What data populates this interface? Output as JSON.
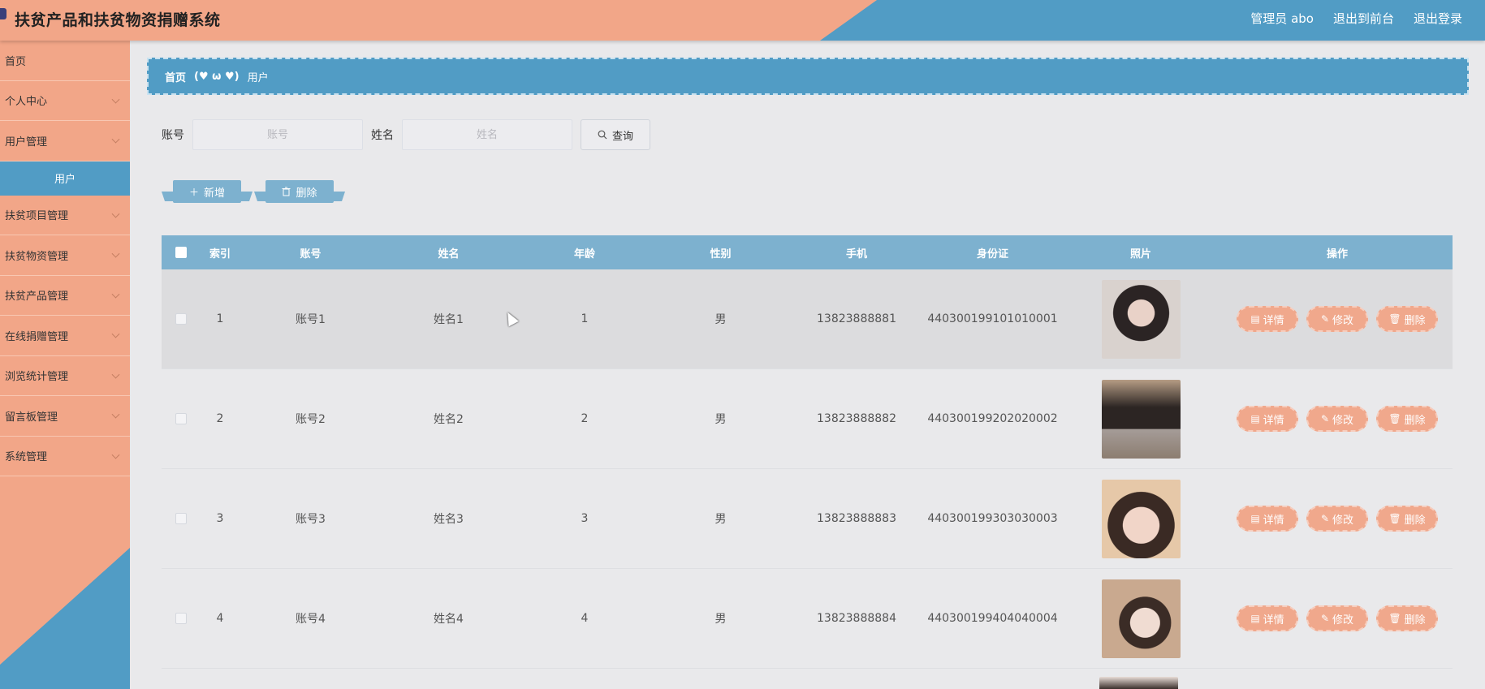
{
  "header": {
    "title": "扶贫产品和扶贫物资捐赠系统",
    "nav": [
      "管理员 abo",
      "退出到前台",
      "退出登录"
    ]
  },
  "sidebar": {
    "items": [
      {
        "label": "首页",
        "has_arrow": false
      },
      {
        "label": "个人中心",
        "has_arrow": true
      },
      {
        "label": "用户管理",
        "has_arrow": true
      },
      {
        "label": "扶贫项目管理",
        "has_arrow": true
      },
      {
        "label": "扶贫物资管理",
        "has_arrow": true
      },
      {
        "label": "扶贫产品管理",
        "has_arrow": true
      },
      {
        "label": "在线捐赠管理",
        "has_arrow": true
      },
      {
        "label": "浏览统计管理",
        "has_arrow": true
      },
      {
        "label": "留言板管理",
        "has_arrow": true
      },
      {
        "label": "系统管理",
        "has_arrow": true
      }
    ],
    "active_subitem": "用户"
  },
  "breadcrumb": {
    "home": "首页",
    "separator": "(♥ ω ♥)",
    "current": "用户"
  },
  "search": {
    "account_label": "账号",
    "account_placeholder": "账号",
    "name_label": "姓名",
    "name_placeholder": "姓名",
    "query_label": "查询"
  },
  "actions": {
    "add_label": "新增",
    "delete_label": "删除"
  },
  "table": {
    "headers": [
      "索引",
      "账号",
      "姓名",
      "年龄",
      "性别",
      "手机",
      "身份证",
      "照片",
      "操作"
    ],
    "rows": [
      {
        "index": "1",
        "account": "账号1",
        "name": "姓名1",
        "age": "1",
        "sex": "男",
        "phone": "13823888881",
        "id_card": "440300199101010001"
      },
      {
        "index": "2",
        "account": "账号2",
        "name": "姓名2",
        "age": "2",
        "sex": "男",
        "phone": "13823888882",
        "id_card": "440300199202020002"
      },
      {
        "index": "3",
        "account": "账号3",
        "name": "姓名3",
        "age": "3",
        "sex": "男",
        "phone": "13823888883",
        "id_card": "440300199303030003"
      },
      {
        "index": "4",
        "account": "账号4",
        "name": "姓名4",
        "age": "4",
        "sex": "男",
        "phone": "13823888884",
        "id_card": "440300199404040004"
      }
    ],
    "ops": {
      "detail": "详情",
      "edit": "修改",
      "delete": "删除"
    }
  },
  "colors": {
    "peach": "#f2a688",
    "blue": "#519cc5",
    "table_header": "#7db1cf",
    "op_button": "#f0a88c"
  },
  "icons": {
    "search": "search-icon",
    "add": "plus-icon",
    "delete": "trash-icon",
    "detail": "document-icon",
    "edit": "pencil-icon",
    "expand": "chevron-down-icon"
  }
}
